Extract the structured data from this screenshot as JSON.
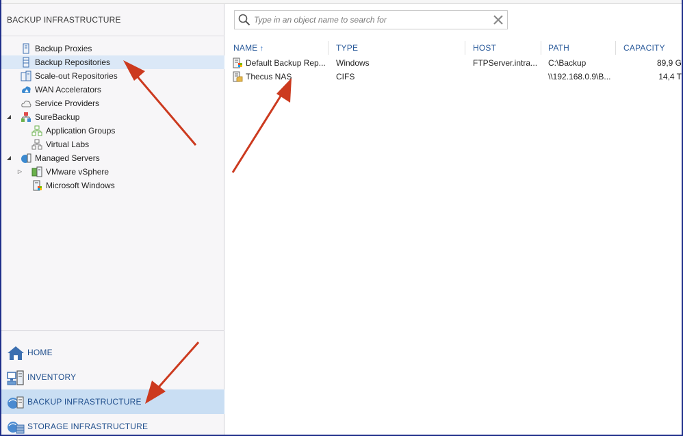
{
  "left_pane": {
    "title": "BACKUP INFRASTRUCTURE",
    "tree": [
      {
        "label": "Backup Proxies",
        "icon": "server-icon",
        "level": 1,
        "expander": "",
        "selected": false
      },
      {
        "label": "Backup Repositories",
        "icon": "repository-icon",
        "level": 1,
        "expander": "",
        "selected": true
      },
      {
        "label": "Scale-out Repositories",
        "icon": "scaleout-repository-icon",
        "level": 1,
        "expander": "",
        "selected": false
      },
      {
        "label": "WAN Accelerators",
        "icon": "wan-accelerator-icon",
        "level": 1,
        "expander": "",
        "selected": false
      },
      {
        "label": "Service Providers",
        "icon": "cloud-icon",
        "level": 1,
        "expander": "",
        "selected": false
      },
      {
        "label": "SureBackup",
        "icon": "surebackup-icon",
        "level": 1,
        "expander": "◢",
        "selected": false
      },
      {
        "label": "Application Groups",
        "icon": "application-group-icon",
        "level": 2,
        "expander": "",
        "selected": false
      },
      {
        "label": "Virtual Labs",
        "icon": "virtual-lab-icon",
        "level": 2,
        "expander": "",
        "selected": false
      },
      {
        "label": "Managed Servers",
        "icon": "managed-servers-icon",
        "level": 1,
        "expander": "◢",
        "selected": false
      },
      {
        "label": "VMware vSphere",
        "icon": "vmware-icon",
        "level": 2,
        "expander": "▷",
        "selected": false
      },
      {
        "label": "Microsoft Windows",
        "icon": "windows-server-icon",
        "level": 2,
        "expander": "",
        "selected": false
      }
    ]
  },
  "nav": [
    {
      "label": "HOME",
      "icon": "home-icon",
      "active": false
    },
    {
      "label": "INVENTORY",
      "icon": "inventory-icon",
      "active": false
    },
    {
      "label": "BACKUP INFRASTRUCTURE",
      "icon": "backup-infrastructure-icon",
      "active": true
    },
    {
      "label": "STORAGE INFRASTRUCTURE",
      "icon": "storage-infrastructure-icon",
      "active": false
    }
  ],
  "search": {
    "placeholder": "Type in an object name to search for"
  },
  "grid": {
    "columns": [
      "NAME",
      "TYPE",
      "HOST",
      "PATH",
      "CAPACITY"
    ],
    "sort_indicator": "↑",
    "rows": [
      {
        "name": "Default Backup Rep...",
        "type": "Windows",
        "host": "FTPServer.intra...",
        "path": "C:\\Backup",
        "capacity": "89,9 G",
        "icon": "windows-repository-icon"
      },
      {
        "name": "Thecus NAS",
        "type": "CIFS",
        "host": "",
        "path": "\\\\192.168.0.9\\B...",
        "capacity": "14,4 T",
        "icon": "cifs-share-icon"
      }
    ]
  },
  "colors": {
    "frame": "#1f2f8a",
    "selection": "#dbe8f7",
    "nav_active": "#c9def3",
    "arrow": "#cc3a1f",
    "header_text": "#2a5a9a"
  }
}
